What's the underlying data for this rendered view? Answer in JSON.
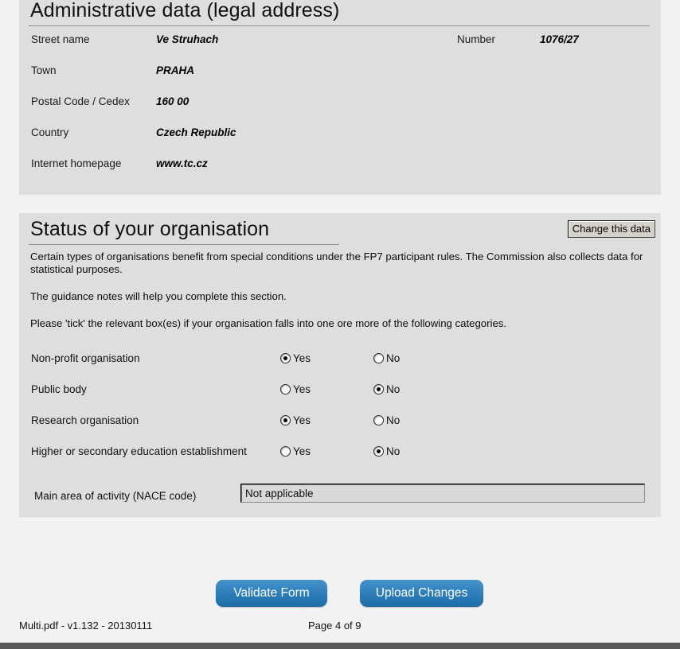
{
  "admin_section": {
    "heading": "Administrative data (legal address)",
    "fields": [
      {
        "label": "Street name",
        "value": "Ve Struhach",
        "label2": "Number",
        "value2": "1076/27"
      },
      {
        "label": "Town",
        "value": "PRAHA"
      },
      {
        "label": "Postal Code / Cedex",
        "value": "160 00"
      },
      {
        "label": "Country",
        "value": "Czech Republic"
      },
      {
        "label": "Internet homepage",
        "value": "www.tc.cz"
      }
    ]
  },
  "status_section": {
    "heading": "Status of your organisation",
    "change_button_label": "Change this data",
    "paragraphs": [
      "Certain types of organisations benefit from special conditions under the FP7 participant rules. The Commission also collects data for statistical purposes.",
      "The guidance notes will help you complete this section.",
      "Please 'tick' the relevant box(es) if your organisation falls into one ore more of the following categories."
    ],
    "yes_label": "Yes",
    "no_label": "No",
    "questions": [
      {
        "label": "Non-profit organisation",
        "selected": "yes"
      },
      {
        "label": "Public body",
        "selected": "no"
      },
      {
        "label": "Research organisation",
        "selected": "yes"
      },
      {
        "label": "Higher or secondary education establishment",
        "selected": "no"
      }
    ],
    "nace": {
      "label": "Main area of activity (NACE code)",
      "value": "Not applicable"
    }
  },
  "actions": {
    "validate_label": "Validate Form",
    "upload_label": "Upload Changes"
  },
  "footer": {
    "document_info": "Multi.pdf - v1.132 - 20130111",
    "page_indicator": "Page 4 of 9"
  },
  "colors": {
    "panel_background": "#dedede",
    "page_background": "#f2f2f2",
    "button_accent": "#2c7cb8",
    "footer_bar": "#585858"
  }
}
